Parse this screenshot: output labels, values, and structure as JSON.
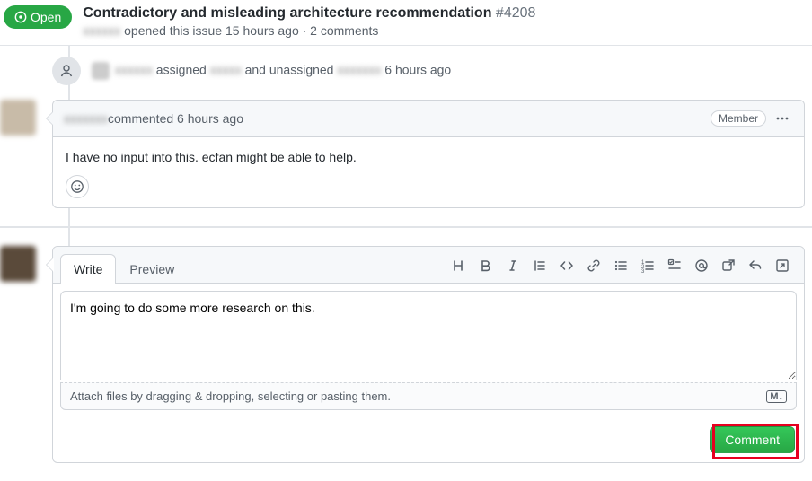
{
  "header": {
    "state_label": "Open",
    "title": "Contradictory and misleading architecture recommendation",
    "issue_number": "#4208",
    "subtitle_before": "opened this issue 15 hours ago · ",
    "subtitle_comments": "2 comments"
  },
  "timeline": {
    "assignment_text": " assigned ",
    "assignment_mid": " and unassigned ",
    "assignment_time": " 6 hours ago"
  },
  "comment1": {
    "header_text": " commented 6 hours ago",
    "role": "Member",
    "body": "I have no input into this. ecfan might be able to help."
  },
  "compose": {
    "tab_write": "Write",
    "tab_preview": "Preview",
    "textarea_value": "I'm going to do some more research on this.",
    "attach_hint": "Attach files by dragging & dropping, selecting or pasting them.",
    "md_badge": "M↓",
    "submit_label": "Comment"
  }
}
